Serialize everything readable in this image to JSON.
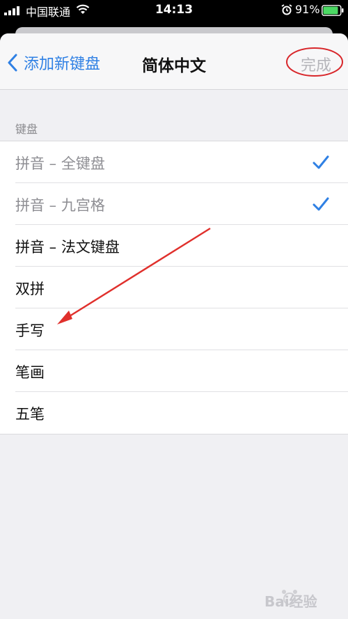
{
  "status_bar": {
    "carrier": "中国联通",
    "time": "14:13",
    "battery_percent": "91%"
  },
  "navbar": {
    "back_label": "添加新键盘",
    "title": "简体中文",
    "done_label": "完成"
  },
  "section": {
    "header": "键盘"
  },
  "keyboards": [
    {
      "label": "拼音 – 全键盘",
      "checked": true,
      "disabled": true
    },
    {
      "label": "拼音 – 九宫格",
      "checked": true,
      "disabled": true
    },
    {
      "label": "拼音 – 法文键盘",
      "checked": false,
      "disabled": false
    },
    {
      "label": "双拼",
      "checked": false,
      "disabled": false
    },
    {
      "label": "手写",
      "checked": false,
      "disabled": false
    },
    {
      "label": "笔画",
      "checked": false,
      "disabled": false
    },
    {
      "label": "五笔",
      "checked": false,
      "disabled": false
    }
  ],
  "annotations": {
    "arrow_color": "#e0302c",
    "circle_color": "#d8262a"
  },
  "watermark": {
    "text": "Bai经验"
  },
  "colors": {
    "accent": "#2f80e4",
    "disabled_text": "#8e8e93",
    "done_disabled": "#b5b5ba"
  },
  "icons": [
    "signal-bars-icon",
    "wifi-icon",
    "alarm-icon",
    "battery-icon",
    "chevron-left-icon",
    "checkmark-icon"
  ]
}
